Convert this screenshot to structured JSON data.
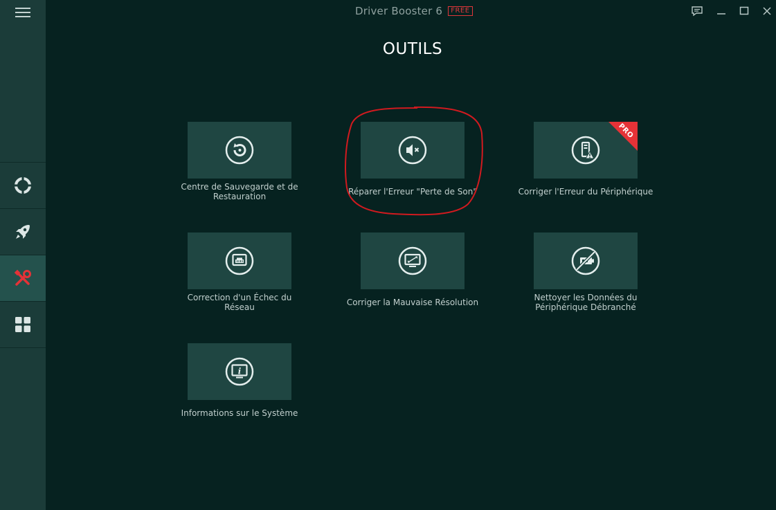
{
  "app": {
    "title": "Driver Booster 6",
    "badge": "FREE",
    "accent_color": "#e53237"
  },
  "sidebar": {
    "items": [
      {
        "name": "scan",
        "icon": "lifebuoy-icon",
        "active": false
      },
      {
        "name": "boost",
        "icon": "rocket-icon",
        "active": false
      },
      {
        "name": "tools",
        "icon": "tools-icon",
        "active": true
      },
      {
        "name": "action-center",
        "icon": "grid-icon",
        "active": false
      }
    ]
  },
  "window_controls": [
    "feedback-icon",
    "minimize-icon",
    "maximize-icon",
    "close-icon"
  ],
  "page": {
    "title": "OUTILS"
  },
  "tools": [
    {
      "label_line1": "Centre de Sauvegarde et de",
      "label_line2": "Restauration",
      "icon": "restore-icon"
    },
    {
      "label_line1": "Réparer l'Erreur \"Perte de Son\"",
      "label_line2": "",
      "icon": "mute-icon"
    },
    {
      "label_line1": "Corriger l'Erreur du Périphérique",
      "label_line2": "",
      "icon": "device-warning-icon",
      "badge": "PRO"
    },
    {
      "label_line1": "Correction d'un Échec du",
      "label_line2": "Réseau",
      "icon": "network-icon"
    },
    {
      "label_line1": "Corriger la Mauvaise Résolution",
      "label_line2": "",
      "icon": "resolution-icon"
    },
    {
      "label_line1": "Nettoyer les Données du",
      "label_line2": "Périphérique Débranché",
      "icon": "unplugged-device-icon"
    },
    {
      "label_line1": "Informations sur le Système",
      "label_line2": "",
      "icon": "system-info-icon"
    }
  ]
}
